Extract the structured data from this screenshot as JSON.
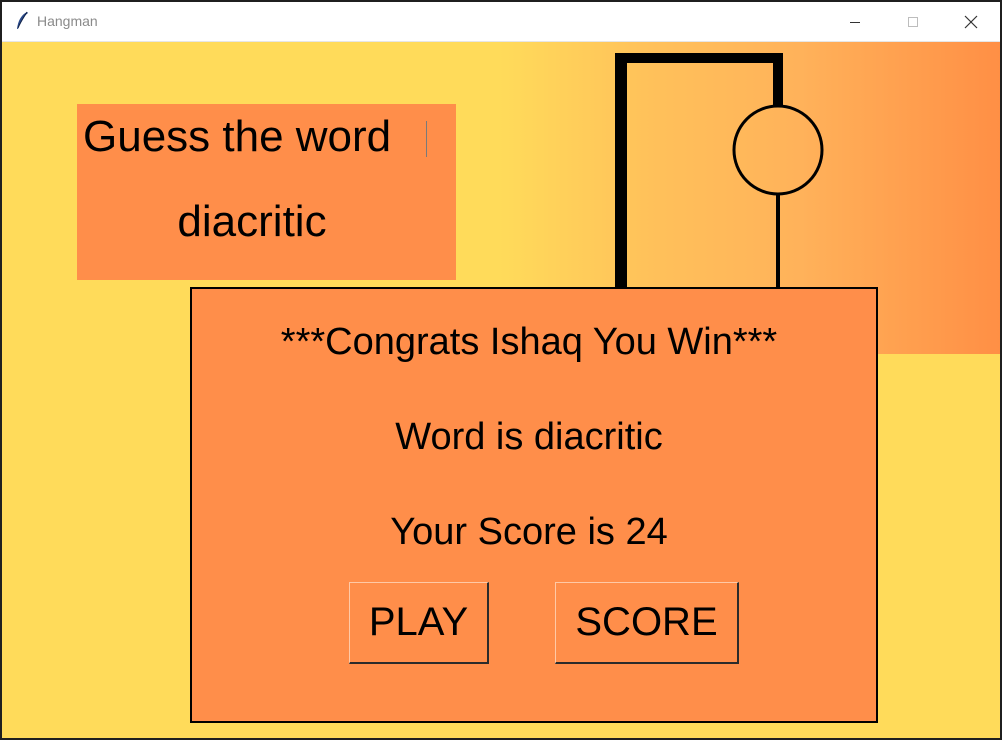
{
  "window": {
    "title": "Hangman",
    "icon": "feather-icon",
    "controls": [
      "minimize-icon",
      "maximize-icon",
      "close-icon"
    ]
  },
  "guess_panel": {
    "heading": "Guess the word",
    "word": "diacritic"
  },
  "result_dialog": {
    "message": "***Congrats Ishaq You Win***",
    "word_line": "Word is diacritic",
    "score_line": "Your Score is 24",
    "play_label": "PLAY",
    "score_label": "SCORE"
  },
  "colors": {
    "background": "#ffdb5a",
    "panel": "#ff8e4a",
    "gradient_end": "#ff8f45"
  }
}
